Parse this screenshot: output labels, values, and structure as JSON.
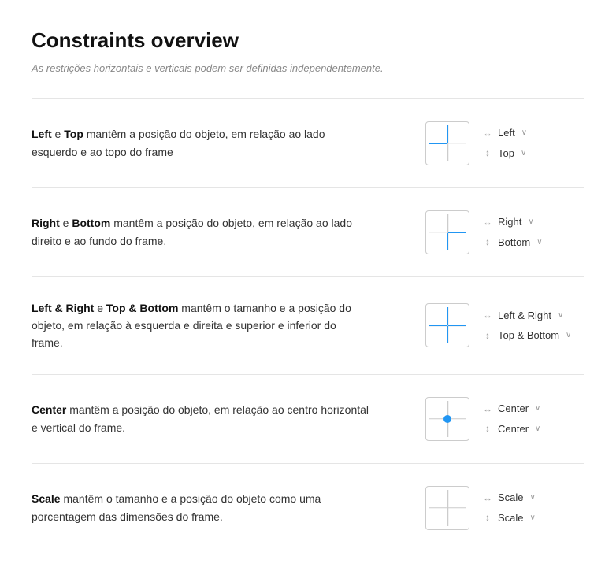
{
  "page": {
    "title": "Constraints overview",
    "subtitle": "As restrições horizontais e verticais podem ser definidas independentemente."
  },
  "sections": [
    {
      "id": "left-top",
      "text_parts": [
        {
          "bold": true,
          "text": "Left"
        },
        {
          "bold": false,
          "text": " e "
        },
        {
          "bold": true,
          "text": "Top"
        },
        {
          "bold": false,
          "text": " mantêm a posição do objeto, em relação ao lado esquerdo e ao topo do frame"
        }
      ],
      "h_control": "Left",
      "v_control": "Top",
      "diagram_type": "left-top"
    },
    {
      "id": "right-bottom",
      "text_parts": [
        {
          "bold": true,
          "text": "Right"
        },
        {
          "bold": false,
          "text": " e "
        },
        {
          "bold": true,
          "text": "Bottom"
        },
        {
          "bold": false,
          "text": " mantêm a posição do objeto, em relação ao lado direito e ao fundo do frame."
        }
      ],
      "h_control": "Right",
      "v_control": "Bottom",
      "diagram_type": "right-bottom"
    },
    {
      "id": "left-right-top-bottom",
      "text_parts": [
        {
          "bold": true,
          "text": "Left & Right"
        },
        {
          "bold": false,
          "text": " e "
        },
        {
          "bold": true,
          "text": "Top & Bottom"
        },
        {
          "bold": false,
          "text": " mantêm o tamanho e a posição do objeto, em relação à esquerda e direita e superior e inferior do frame."
        }
      ],
      "h_control": "Left & Right",
      "v_control": "Top & Bottom",
      "diagram_type": "left-right-top-bottom"
    },
    {
      "id": "center",
      "text_parts": [
        {
          "bold": true,
          "text": "Center"
        },
        {
          "bold": false,
          "text": " mantêm a posição do objeto, em relação ao centro horizontal e vertical do frame."
        }
      ],
      "h_control": "Center",
      "v_control": "Center",
      "diagram_type": "center"
    },
    {
      "id": "scale",
      "text_parts": [
        {
          "bold": true,
          "text": "Scale"
        },
        {
          "bold": false,
          "text": " mantêm o tamanho e a posição do objeto como uma porcentagem das dimensões do frame."
        }
      ],
      "h_control": "Scale",
      "v_control": "Scale",
      "diagram_type": "scale"
    }
  ],
  "icons": {
    "horizontal": "↔",
    "vertical": "↕",
    "chevron": "∨"
  }
}
